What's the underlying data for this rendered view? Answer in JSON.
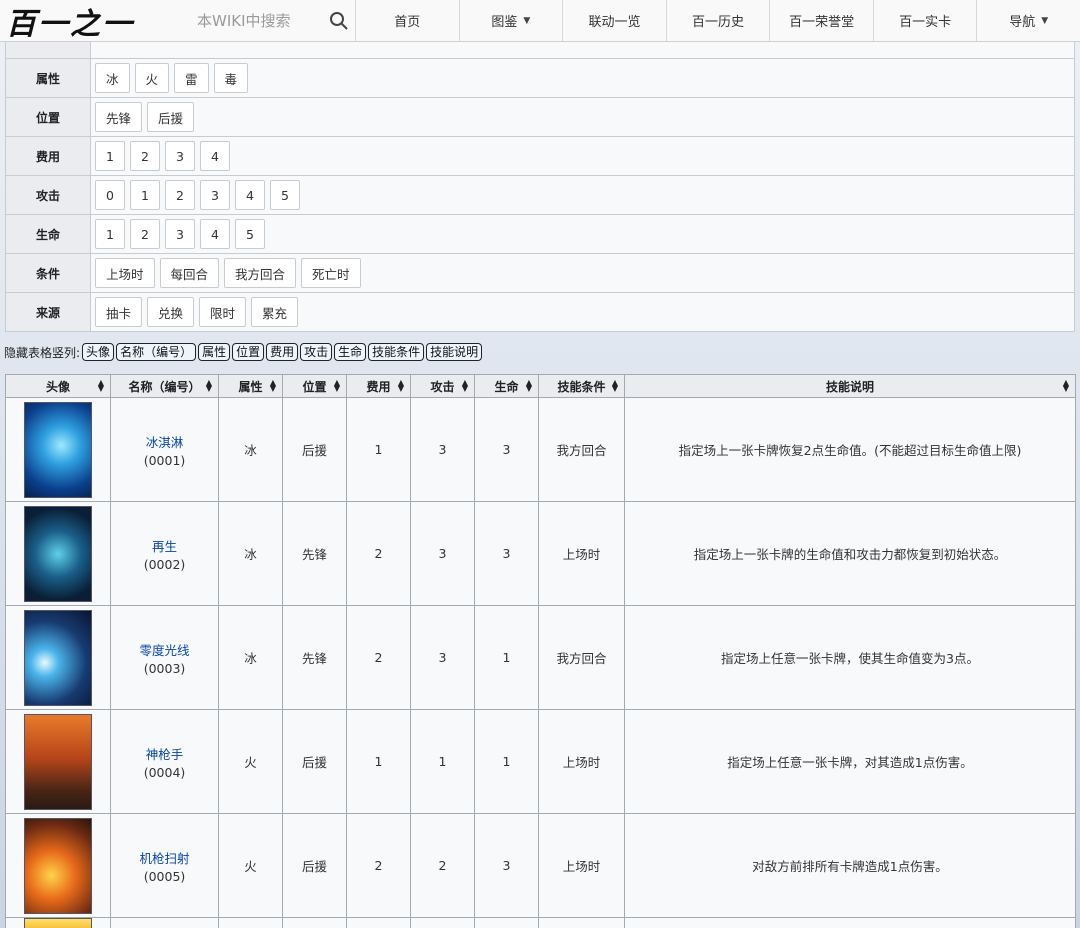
{
  "header": {
    "logo": "百一之一",
    "search_placeholder": "本WIKI中搜索",
    "nav": [
      {
        "label": "首页",
        "dropdown": false
      },
      {
        "label": "图鉴",
        "dropdown": true
      },
      {
        "label": "联动一览",
        "dropdown": false
      },
      {
        "label": "百一历史",
        "dropdown": false
      },
      {
        "label": "百一荣誉堂",
        "dropdown": false
      },
      {
        "label": "百一实卡",
        "dropdown": false
      },
      {
        "label": "导航",
        "dropdown": true
      }
    ]
  },
  "filters": [
    {
      "label": "属性",
      "options": [
        "冰",
        "火",
        "雷",
        "毒"
      ]
    },
    {
      "label": "位置",
      "options": [
        "先锋",
        "后援"
      ]
    },
    {
      "label": "费用",
      "options": [
        "1",
        "2",
        "3",
        "4"
      ]
    },
    {
      "label": "攻击",
      "options": [
        "0",
        "1",
        "2",
        "3",
        "4",
        "5"
      ]
    },
    {
      "label": "生命",
      "options": [
        "1",
        "2",
        "3",
        "4",
        "5"
      ]
    },
    {
      "label": "条件",
      "options": [
        "上场时",
        "每回合",
        "我方回合",
        "死亡时"
      ]
    },
    {
      "label": "来源",
      "options": [
        "抽卡",
        "兑换",
        "限时",
        "累充"
      ]
    }
  ],
  "hide_columns": {
    "label": "隐藏表格竖列:",
    "buttons": [
      "头像",
      "名称（编号）",
      "属性",
      "位置",
      "费用",
      "攻击",
      "生命",
      "技能条件",
      "技能说明"
    ]
  },
  "table": {
    "headers": [
      "头像",
      "名称（编号）",
      "属性",
      "位置",
      "费用",
      "攻击",
      "生命",
      "技能条件",
      "技能说明"
    ],
    "rows": [
      {
        "name": "冰淇淋",
        "code": "(0001)",
        "attr": "冰",
        "pos": "后援",
        "cost": "1",
        "atk": "3",
        "hp": "3",
        "cond": "我方回合",
        "desc": "指定场上一张卡牌恢复2点生命值。(不能超过目标生命值上限)"
      },
      {
        "name": "再生",
        "code": "(0002)",
        "attr": "冰",
        "pos": "先锋",
        "cost": "2",
        "atk": "3",
        "hp": "3",
        "cond": "上场时",
        "desc": "指定场上一张卡牌的生命值和攻击力都恢复到初始状态。"
      },
      {
        "name": "零度光线",
        "code": "(0003)",
        "attr": "冰",
        "pos": "先锋",
        "cost": "2",
        "atk": "3",
        "hp": "1",
        "cond": "我方回合",
        "desc": "指定场上任意一张卡牌，使其生命值变为3点。"
      },
      {
        "name": "神枪手",
        "code": "(0004)",
        "attr": "火",
        "pos": "后援",
        "cost": "1",
        "atk": "1",
        "hp": "1",
        "cond": "上场时",
        "desc": "指定场上任意一张卡牌，对其造成1点伤害。"
      },
      {
        "name": "机枪扫射",
        "code": "(0005)",
        "attr": "火",
        "pos": "后援",
        "cost": "2",
        "atk": "2",
        "hp": "3",
        "cond": "上场时",
        "desc": "对敌方前排所有卡牌造成1点伤害。"
      }
    ]
  }
}
